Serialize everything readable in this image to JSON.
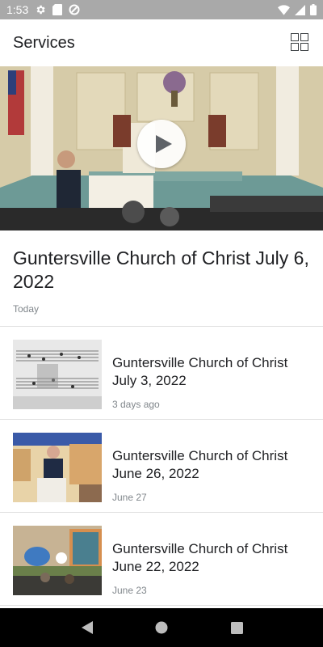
{
  "status_bar": {
    "time": "1:53",
    "left_icons": [
      "gear-icon",
      "sd-card-icon",
      "data-saver-icon"
    ],
    "right_icons": [
      "wifi-icon",
      "signal-icon",
      "battery-icon"
    ]
  },
  "app_bar": {
    "title": "Services",
    "grid_icon": "grid-view-icon"
  },
  "featured": {
    "title": "Guntersville Church of Christ July 6, 2022",
    "date": "Today",
    "play_icon": "play-icon"
  },
  "services": [
    {
      "title": "Guntersville Church of Christ July 3, 2022",
      "date": "3 days ago"
    },
    {
      "title": "Guntersville Church of Christ June 26, 2022",
      "date": "June 27"
    },
    {
      "title": "Guntersville Church of Christ June 22, 2022",
      "date": "June 23"
    }
  ],
  "nav_bar": {
    "buttons": [
      "back-icon",
      "home-icon",
      "recents-icon"
    ]
  },
  "colors": {
    "status_bar": "#a9a9a9",
    "nav_bar": "#000000",
    "text_primary": "#202124",
    "text_secondary": "#80868b",
    "divider": "#e0e0e0"
  }
}
